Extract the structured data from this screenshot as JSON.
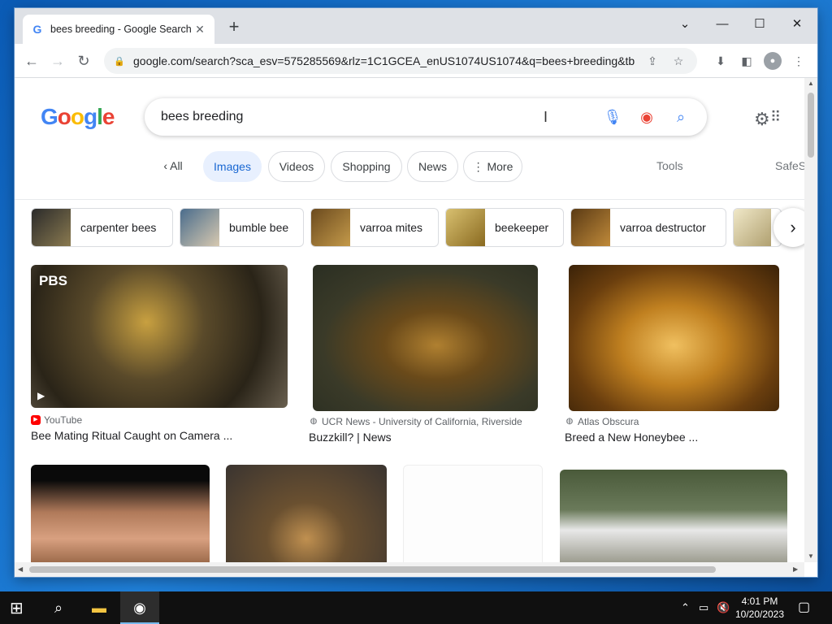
{
  "browser": {
    "tab_title": "bees breeding - Google Search",
    "url": "google.com/search?sca_esv=575285569&rlz=1C1GCEA_enUS1074US1074&q=bees+breeding&tbm=..."
  },
  "search": {
    "query": "bees breeding",
    "filters": [
      "All",
      "Images",
      "Videos",
      "Shopping",
      "News",
      "More"
    ],
    "active_filter": "Images",
    "tools_label": "Tools",
    "safesearch_label": "SafeS"
  },
  "related": [
    {
      "label": "carpenter bees"
    },
    {
      "label": "bumble bee"
    },
    {
      "label": "varroa mites"
    },
    {
      "label": "beekeeper"
    },
    {
      "label": "varroa destructor"
    }
  ],
  "results": [
    {
      "source": "YouTube",
      "caption": "Bee Mating Ritual Caught on Camera ...",
      "badge": "PBS"
    },
    {
      "source": "UCR News - University of California, Riverside",
      "caption": "Buzzkill? | News"
    },
    {
      "source": "Atlas Obscura",
      "caption": "Breed a New Honeybee ..."
    }
  ],
  "taskbar": {
    "time": "4:01 PM",
    "date": "10/20/2023"
  },
  "colors": {
    "accent": "#1967d2",
    "chip_active_bg": "#e8f0fe",
    "taskbar": "#101010"
  }
}
